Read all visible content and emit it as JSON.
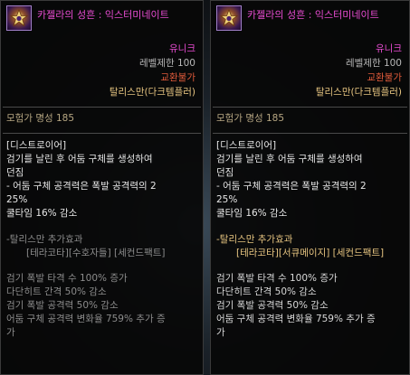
{
  "left": {
    "item_name": "카젤라의 성흔 : 익스터미네이트",
    "rarity": "유니크",
    "level_limit": "레벨제한 100",
    "trade": "교환불가",
    "owner": "탈리스만(다크템플러)",
    "fame": "모험가 명성 185",
    "skill_title": "[디스트로이어]",
    "skill_desc_1": "검기를 날린 후 어둠 구체를 생성하여",
    "skill_desc_2": "던짐",
    "bullet_1": "- 어둠 구체 공격력은 폭발 공격력의 2",
    "bullet_2": "25%",
    "cooldown": "쿨타임 16% 감소",
    "talisman_head": "-탈리스만 추가효과",
    "talisman_runes": "[테라코타][수호자들] [세컨드팩트]",
    "effects": [
      "검기 폭발 타격 수 100% 증가",
      "다단히트 간격 50% 감소",
      "검기 폭발 공격력 50% 감소",
      "어둠 구체 공격력 변화율 759% 추가 증",
      "가"
    ]
  },
  "right": {
    "item_name": "카젤라의 성흔 : 익스터미네이트",
    "rarity": "유니크",
    "level_limit": "레벨제한 100",
    "trade": "교환불가",
    "owner": "탈리스만(다크템플러)",
    "fame": "모험가 명성 185",
    "skill_title": "[디스트로이어]",
    "skill_desc_1": "검기를 날린 후 어둠 구체를 생성하여",
    "skill_desc_2": "던짐",
    "bullet_1": "- 어둠 구체 공격력은 폭발 공격력의 2",
    "bullet_2": "25%",
    "cooldown": "쿨타임 16% 감소",
    "talisman_head": "-탈리스만 추가효과",
    "talisman_runes": "[테라코타][서큐메이지] [세컨드팩트]",
    "effects": [
      "검기 폭발 타격 수 100% 증가",
      "다단히트 간격 50% 감소",
      "검기 폭발 공격력 50% 감소",
      "어둠 구체 공격력 변화율 759% 추가 증",
      "가"
    ]
  },
  "colors": {
    "unique": "#e84cd2",
    "untradeable": "#e05a3a",
    "owner": "#e6c480",
    "inactive": "#8c8c8c"
  },
  "icons": {
    "item_icon": "talisman-emblem-icon"
  }
}
